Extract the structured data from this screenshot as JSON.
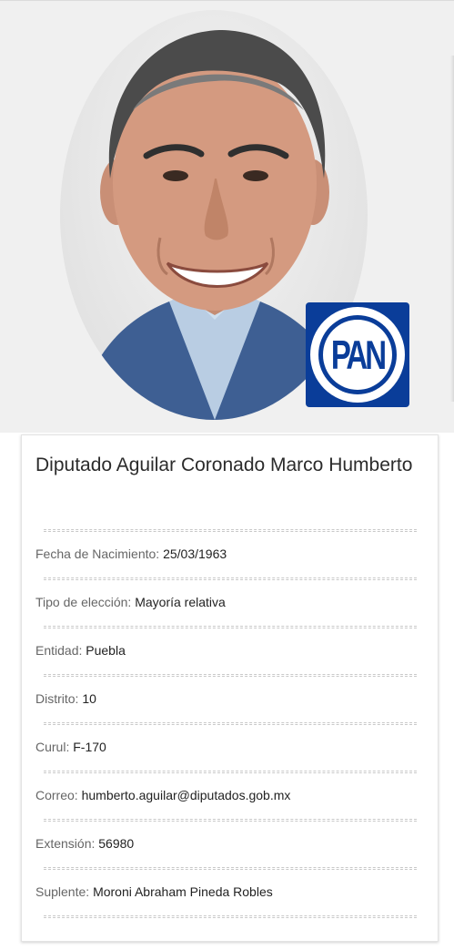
{
  "profile": {
    "photo_alt": "Retrato del diputado",
    "party_logo": {
      "text": "PAN",
      "color": "#0a3d99"
    }
  },
  "card": {
    "title": "Diputado Aguilar Coronado Marco Humberto",
    "fields": [
      {
        "label": "Fecha de Nacimiento:",
        "value": "25/03/1963"
      },
      {
        "label": "Tipo de elección:",
        "value": "Mayoría relativa"
      },
      {
        "label": "Entidad:",
        "value": "Puebla"
      },
      {
        "label": "Distrito:",
        "value": "10"
      },
      {
        "label": "Curul:",
        "value": "F-170"
      },
      {
        "label": "Correo:",
        "value": "humberto.aguilar@diputados.gob.mx"
      },
      {
        "label": "Extensión:",
        "value": "56980"
      },
      {
        "label": "Suplente:",
        "value": "Moroni Abraham Pineda Robles"
      }
    ]
  }
}
